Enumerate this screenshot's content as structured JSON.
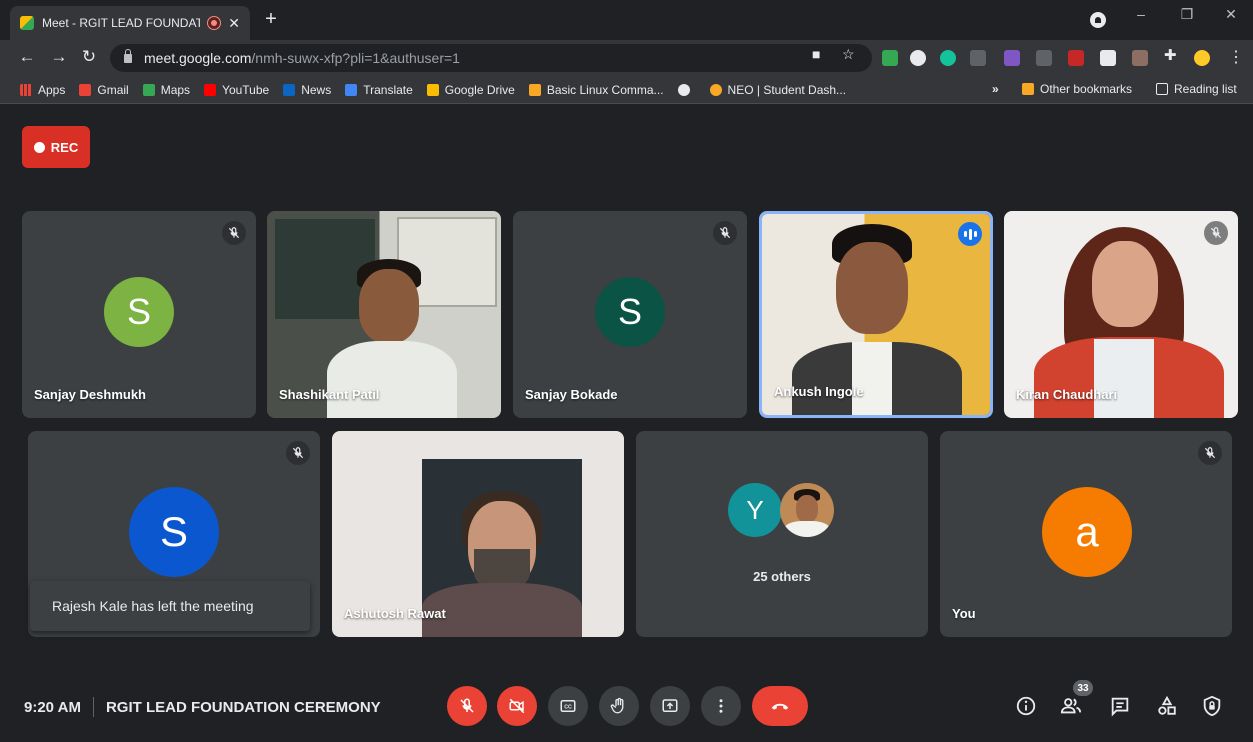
{
  "browser": {
    "tab_title": "Meet - RGIT LEAD FOUNDAT",
    "url_host": "meet.google.com",
    "url_path": "/nmh-suwx-xfp?pli=1&authuser=1",
    "bookmarks": [
      {
        "label": "Apps",
        "color": "#4285f4"
      },
      {
        "label": "Gmail",
        "color": "#ea4335"
      },
      {
        "label": "Maps",
        "color": "#34a853"
      },
      {
        "label": "YouTube",
        "color": "#ff0000"
      },
      {
        "label": "News",
        "color": "#0a66c2"
      },
      {
        "label": "Translate",
        "color": "#4285f4"
      },
      {
        "label": "Google Drive",
        "color": "#fbbc04"
      },
      {
        "label": "Basic Linux Comma...",
        "color": "#f9a825"
      },
      {
        "label": "",
        "color": "#e8eaed"
      },
      {
        "label": "NEO | Student Dash...",
        "color": "#f9a825"
      }
    ],
    "other_bookmarks": "Other bookmarks",
    "reading_list": "Reading list"
  },
  "meet": {
    "rec_label": "REC",
    "participants": [
      {
        "name": "Sanjay Deshmukh",
        "initial": "S",
        "avatar_color": "#7cb342",
        "muted": true
      },
      {
        "name": "Shashikant Patil",
        "muted": false
      },
      {
        "name": "Sanjay Bokade",
        "initial": "S",
        "avatar_color": "#0b5345",
        "muted": true
      },
      {
        "name": "Ankush Ingole",
        "muted": false,
        "speaking": true
      },
      {
        "name": "Kiran Chaudhari",
        "muted": true
      },
      {
        "name": "",
        "initial": "S",
        "avatar_color": "#0b57d0",
        "muted": true
      },
      {
        "name": "Ashutosh Rawat",
        "muted": false
      },
      {
        "name": "",
        "initial": "Y",
        "avatar_color": "#12939a",
        "muted": false
      },
      {
        "name": "You",
        "initial": "a",
        "avatar_color": "#f57c00",
        "muted": true
      }
    ],
    "others_label": "25 others",
    "toast": "Rajesh Kale has left the meeting",
    "time": "9:20 AM",
    "meeting_title": "RGIT LEAD FOUNDATION CEREMONY",
    "participant_count": "33"
  }
}
